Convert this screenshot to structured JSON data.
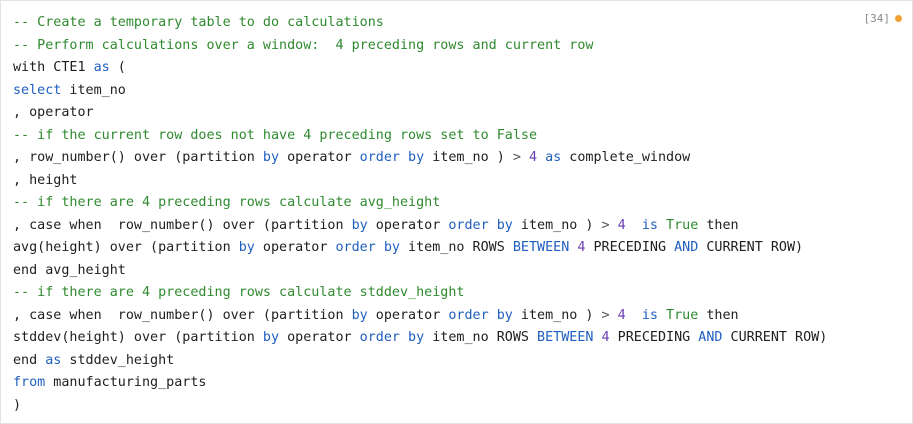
{
  "cell": {
    "execution_count": "[34]",
    "status_color": "#f0a030"
  },
  "colors": {
    "comment": "#2f8a2f",
    "keyword": "#1f5fbf",
    "number": "#6a3fb5",
    "boolean": "#2f8a2f",
    "identifier": "#1f1f1f"
  },
  "code_lines": [
    [
      {
        "t": "comment",
        "v": "-- Create a temporary table to do calculations"
      }
    ],
    [
      {
        "t": "comment",
        "v": "-- Perform calculations over a window:  4 preceding rows and current row"
      }
    ],
    [
      {
        "t": "ident",
        "v": "with CTE1 "
      },
      {
        "t": "kw",
        "v": "as"
      },
      {
        "t": "ident",
        "v": " ("
      }
    ],
    [
      {
        "t": "kw",
        "v": "select"
      },
      {
        "t": "ident",
        "v": " item_no"
      }
    ],
    [
      {
        "t": "ident",
        "v": ", operator"
      }
    ],
    [
      {
        "t": "comment",
        "v": "-- if the current row does not have 4 preceding rows set to False"
      }
    ],
    [
      {
        "t": "ident",
        "v": ", row_number() over (partition "
      },
      {
        "t": "kw",
        "v": "by"
      },
      {
        "t": "ident",
        "v": " operator "
      },
      {
        "t": "kw",
        "v": "order by"
      },
      {
        "t": "ident",
        "v": " item_no ) "
      },
      {
        "t": "op",
        "v": ">"
      },
      {
        "t": "ident",
        "v": " "
      },
      {
        "t": "num",
        "v": "4"
      },
      {
        "t": "ident",
        "v": " "
      },
      {
        "t": "kw",
        "v": "as"
      },
      {
        "t": "ident",
        "v": " complete_window"
      }
    ],
    [
      {
        "t": "ident",
        "v": ", height"
      }
    ],
    [
      {
        "t": "comment",
        "v": "-- if there are 4 preceding rows calculate avg_height"
      }
    ],
    [
      {
        "t": "ident",
        "v": ", case when  row_number() over (partition "
      },
      {
        "t": "kw",
        "v": "by"
      },
      {
        "t": "ident",
        "v": " operator "
      },
      {
        "t": "kw",
        "v": "order by"
      },
      {
        "t": "ident",
        "v": " item_no ) "
      },
      {
        "t": "op",
        "v": ">"
      },
      {
        "t": "ident",
        "v": " "
      },
      {
        "t": "num",
        "v": "4"
      },
      {
        "t": "ident",
        "v": "  "
      },
      {
        "t": "kw",
        "v": "is"
      },
      {
        "t": "ident",
        "v": " "
      },
      {
        "t": "bool",
        "v": "True"
      },
      {
        "t": "ident",
        "v": " then"
      }
    ],
    [
      {
        "t": "ident",
        "v": "avg(height) over (partition "
      },
      {
        "t": "kw",
        "v": "by"
      },
      {
        "t": "ident",
        "v": " operator "
      },
      {
        "t": "kw",
        "v": "order by"
      },
      {
        "t": "ident",
        "v": " item_no ROWS "
      },
      {
        "t": "kw",
        "v": "BETWEEN"
      },
      {
        "t": "ident",
        "v": " "
      },
      {
        "t": "num",
        "v": "4"
      },
      {
        "t": "ident",
        "v": " PRECEDING "
      },
      {
        "t": "kw",
        "v": "AND"
      },
      {
        "t": "ident",
        "v": " CURRENT ROW)"
      }
    ],
    [
      {
        "t": "ident",
        "v": "end avg_height"
      }
    ],
    [
      {
        "t": "comment",
        "v": "-- if there are 4 preceding rows calculate stddev_height"
      }
    ],
    [
      {
        "t": "ident",
        "v": ", case when  row_number() over (partition "
      },
      {
        "t": "kw",
        "v": "by"
      },
      {
        "t": "ident",
        "v": " operator "
      },
      {
        "t": "kw",
        "v": "order by"
      },
      {
        "t": "ident",
        "v": " item_no ) "
      },
      {
        "t": "op",
        "v": ">"
      },
      {
        "t": "ident",
        "v": " "
      },
      {
        "t": "num",
        "v": "4"
      },
      {
        "t": "ident",
        "v": "  "
      },
      {
        "t": "kw",
        "v": "is"
      },
      {
        "t": "ident",
        "v": " "
      },
      {
        "t": "bool",
        "v": "True"
      },
      {
        "t": "ident",
        "v": " then"
      }
    ],
    [
      {
        "t": "ident",
        "v": "stddev(height) over (partition "
      },
      {
        "t": "kw",
        "v": "by"
      },
      {
        "t": "ident",
        "v": " operator "
      },
      {
        "t": "kw",
        "v": "order by"
      },
      {
        "t": "ident",
        "v": " item_no ROWS "
      },
      {
        "t": "kw",
        "v": "BETWEEN"
      },
      {
        "t": "ident",
        "v": " "
      },
      {
        "t": "num",
        "v": "4"
      },
      {
        "t": "ident",
        "v": " PRECEDING "
      },
      {
        "t": "kw",
        "v": "AND"
      },
      {
        "t": "ident",
        "v": " CURRENT ROW)"
      }
    ],
    [
      {
        "t": "ident",
        "v": "end "
      },
      {
        "t": "kw",
        "v": "as"
      },
      {
        "t": "ident",
        "v": " stddev_height"
      }
    ],
    [
      {
        "t": "kw",
        "v": "from"
      },
      {
        "t": "ident",
        "v": " manufacturing_parts"
      }
    ],
    [
      {
        "t": "ident",
        "v": ")"
      }
    ]
  ]
}
